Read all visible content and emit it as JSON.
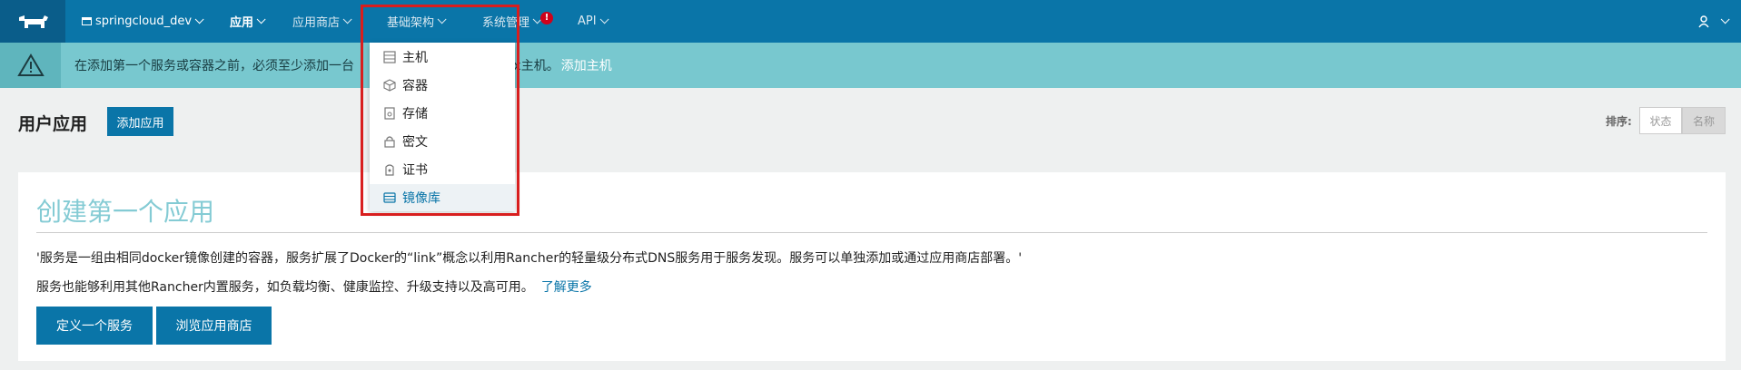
{
  "nav": {
    "env": "springcloud_dev",
    "items": [
      {
        "label": "应用"
      },
      {
        "label": "应用商店"
      },
      {
        "label": "基础架构"
      },
      {
        "label": "系统管理"
      },
      {
        "label": "API"
      }
    ],
    "alert_badge": "!"
  },
  "banner": {
    "text": "在添加第一个服务或容器之前，必须至少添加一台支持Docker版本的Linux主机。",
    "text_visible_left": "在添加第一个服务或容器之前，必须至少添加一台",
    "text_visible_right": "本的Linux主机。",
    "link": "添加主机"
  },
  "page": {
    "title": "用户应用",
    "add_button": "添加应用",
    "sort_label": "排序:",
    "sort_options": [
      "状态",
      "名称"
    ]
  },
  "card": {
    "title": "创建第一个应用",
    "p1": "'服务是一组由相同docker镜像创建的容器，服务扩展了Docker的“link”概念以利用Rancher的轻量级分布式DNS服务用于服务发现。服务可以单独添加或通过应用商店部署。'",
    "p2": "服务也能够利用其他Rancher内置服务，如负载均衡、健康监控、升级支持以及高可用。",
    "p2_link": "了解更多",
    "btn_define": "定义一个服务",
    "btn_browse": "浏览应用商店"
  },
  "dropdown": {
    "items": [
      {
        "label": "主机",
        "icon": "host-icon"
      },
      {
        "label": "容器",
        "icon": "container-icon"
      },
      {
        "label": "存储",
        "icon": "storage-icon"
      },
      {
        "label": "密文",
        "icon": "secret-icon"
      },
      {
        "label": "证书",
        "icon": "certificate-icon"
      },
      {
        "label": "镜像库",
        "icon": "registry-icon"
      }
    ]
  },
  "colors": {
    "nav_bg": "#0a75a8",
    "banner_bg": "#78c8cf",
    "highlight": "#d81e1e"
  }
}
